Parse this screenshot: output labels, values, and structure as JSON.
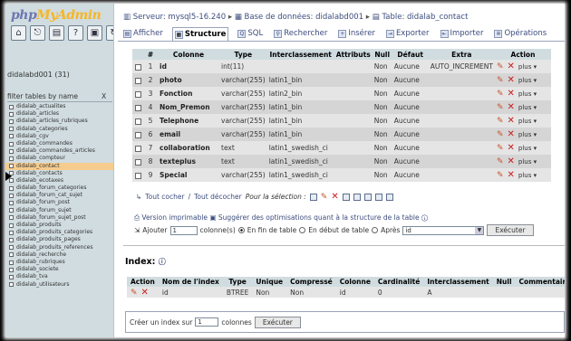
{
  "sidebar": {
    "logo_part1": "php",
    "logo_part2": "MyAdmin",
    "db_label": "didalabd001 (31)",
    "filter_placeholder": "filter tables by name",
    "filter_clear": "X",
    "tables": [
      "didalab_actualites",
      "didalab_articles",
      "didalab_articles_rubriques",
      "didalab_categories",
      "didalab_cgv",
      "didalab_commandes",
      "didalab_commandes_articles",
      "didalab_compteur",
      "didalab_contact",
      "didalab_contacts",
      "didalab_ecotaxes",
      "didalab_forum_categories",
      "didalab_forum_cat_sujet",
      "didalab_forum_post",
      "didalab_forum_sujet",
      "didalab_forum_sujet_post",
      "didalab_produits",
      "didalab_produits_categories",
      "didalab_produits_pages",
      "didalab_produits_references",
      "didalab_recherche",
      "didalab_rubriques",
      "didalab_societe",
      "didalab_tva",
      "didalab_utilisateurs"
    ],
    "selected_table": "didalab_contact"
  },
  "breadcrumb": {
    "server": "Serveur: mysql5-16.240",
    "database": "Base de données: didalabd001",
    "table": "Table: didalab_contact",
    "sep": "▸"
  },
  "tabs": [
    "Afficher",
    "Structure",
    "SQL",
    "Rechercher",
    "Insérer",
    "Exporter",
    "Importer",
    "Opérations"
  ],
  "active_tab": "Structure",
  "fields_table": {
    "headers": [
      "",
      "#",
      "Colonne",
      "Type",
      "Interclassement",
      "Attributs",
      "Null",
      "Défaut",
      "Extra",
      "Action"
    ],
    "rows": [
      {
        "num": "1",
        "name": "id",
        "type": "int(11)",
        "collation": "",
        "attributes": "",
        "null": "Non",
        "default": "Aucune",
        "extra": "AUTO_INCREMENT"
      },
      {
        "num": "2",
        "name": "photo",
        "type": "varchar(255)",
        "collation": "latin1_bin",
        "attributes": "",
        "null": "Non",
        "default": "Aucune",
        "extra": ""
      },
      {
        "num": "3",
        "name": "Fonction",
        "type": "varchar(255)",
        "collation": "latin2_bin",
        "attributes": "",
        "null": "Non",
        "default": "Aucune",
        "extra": ""
      },
      {
        "num": "4",
        "name": "Nom_Premon",
        "type": "varchar(255)",
        "collation": "latin1_bin",
        "attributes": "",
        "null": "Non",
        "default": "Aucune",
        "extra": ""
      },
      {
        "num": "5",
        "name": "Telephone",
        "type": "varchar(255)",
        "collation": "latin1_bin",
        "attributes": "",
        "null": "Non",
        "default": "Aucune",
        "extra": ""
      },
      {
        "num": "6",
        "name": "email",
        "type": "varchar(255)",
        "collation": "latin1_bin",
        "attributes": "",
        "null": "Non",
        "default": "Aucune",
        "extra": ""
      },
      {
        "num": "7",
        "name": "collaboration",
        "type": "text",
        "collation": "latin1_swedish_ci",
        "attributes": "",
        "null": "Non",
        "default": "Aucune",
        "extra": ""
      },
      {
        "num": "8",
        "name": "texteplus",
        "type": "text",
        "collation": "latin1_swedish_ci",
        "attributes": "",
        "null": "Non",
        "default": "Aucune",
        "extra": ""
      },
      {
        "num": "9",
        "name": "Special",
        "type": "varchar(255)",
        "collation": "latin1_swedish_ci",
        "attributes": "",
        "null": "Non",
        "default": "Aucune",
        "extra": ""
      }
    ],
    "plus_label": "plus ▾"
  },
  "check_row": {
    "all": "Tout cocher",
    "sep": " / ",
    "none": "Tout décocher",
    "selection": "Pour la sélection :"
  },
  "print_row": {
    "printable": "Version imprimable",
    "suggest": "Suggérer des optimisations quant à la structure de la table"
  },
  "add_row": {
    "label": "Ajouter",
    "count": "1",
    "columns": "colonne(s)",
    "opt_end": "En fin de table",
    "opt_start": "En début de table",
    "opt_after": "Après",
    "after_value": "id",
    "submit": "Exécuter"
  },
  "indexes": {
    "title": "Index:",
    "headers": [
      "Action",
      "Nom de l'index",
      "Type",
      "Unique",
      "Compressé",
      "Colonne",
      "Cardinalité",
      "Interclassement",
      "Null",
      "Commentaire"
    ],
    "rows": [
      {
        "name": "id",
        "type": "BTREE",
        "unique": "Non",
        "packed": "Non",
        "column": "id",
        "cardinality": "0",
        "collation": "A",
        "null": "",
        "comment": ""
      }
    ]
  },
  "create_index": {
    "label": "Créer un index sur",
    "count": "1",
    "columns": "colonnes",
    "submit": "Exécuter"
  }
}
